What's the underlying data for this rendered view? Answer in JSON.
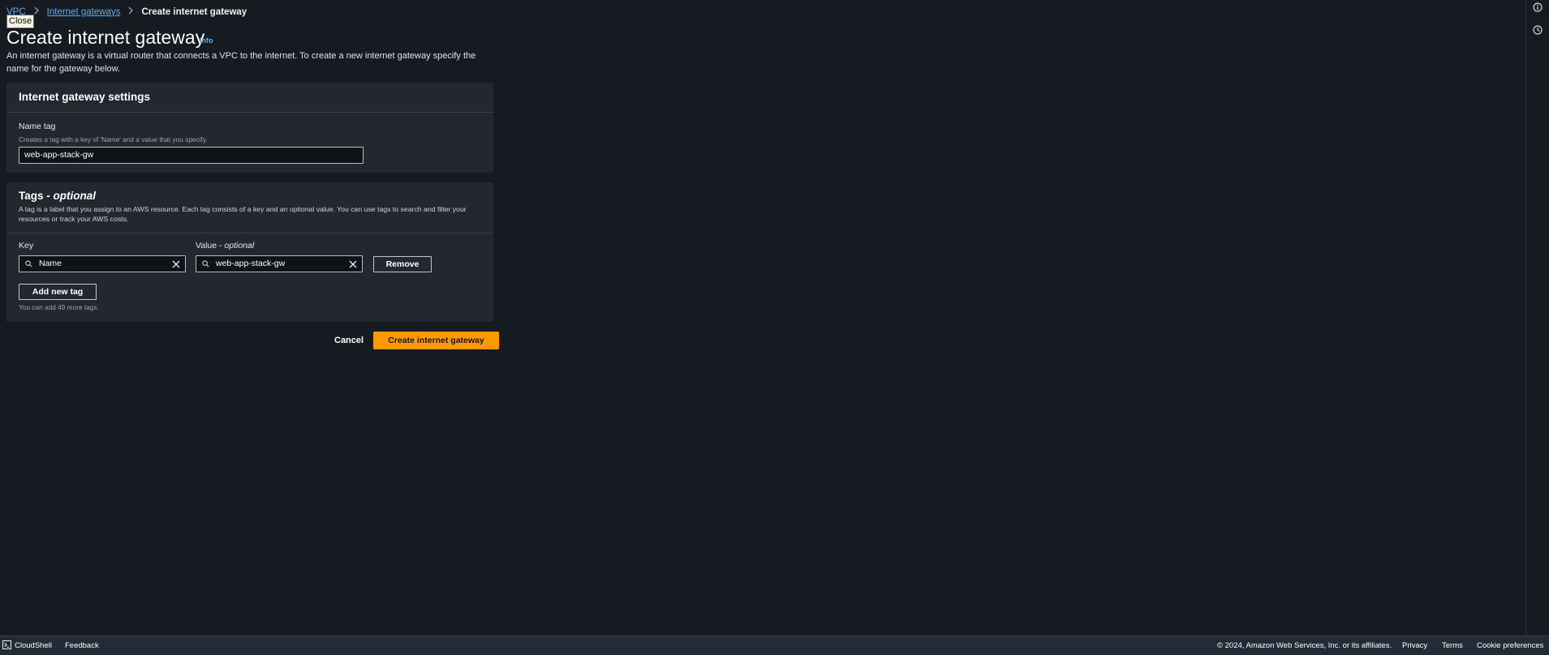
{
  "breadcrumb": {
    "root": "VPC",
    "parent": "Internet gateways",
    "current": "Create internet gateway"
  },
  "tooltip": "Close",
  "page": {
    "title": "Create internet gateway",
    "info": "Info",
    "description": "An internet gateway is a virtual router that connects a VPC to the internet. To create a new internet gateway specify the name for the gateway below."
  },
  "settings": {
    "header": "Internet gateway settings",
    "name_label": "Name tag",
    "name_hint": "Creates a tag with a key of 'Name' and a value that you specify.",
    "name_value": "web-app-stack-gw"
  },
  "tags": {
    "header": "Tags - ",
    "header_optional": "optional",
    "description": "A tag is a label that you assign to an AWS resource. Each tag consists of a key and an optional value. You can use tags to search and filter your resources or track your AWS costs.",
    "key_label": "Key",
    "value_label": "Value - ",
    "value_label_optional": "optional",
    "key_value": "Name",
    "value_value": "web-app-stack-gw",
    "remove": "Remove",
    "add": "Add new tag",
    "add_hint": "You can add 49 more tags."
  },
  "actions": {
    "cancel": "Cancel",
    "submit": "Create internet gateway"
  },
  "footer": {
    "cloudshell": "CloudShell",
    "feedback": "Feedback",
    "copyright": "© 2024, Amazon Web Services, Inc. or its affiliates.",
    "privacy": "Privacy",
    "terms": "Terms",
    "cookies": "Cookie preferences"
  },
  "icons": {
    "breadcrumb": "chevron-right-icon",
    "search": "search-icon",
    "clear": "close-icon",
    "rail_info": "info-circle-icon",
    "rail_history": "clock-icon",
    "cloudshell": "terminal-icon"
  },
  "colors": {
    "primary": "#ff9900",
    "link": "#5ab0f0",
    "background": "#161a21",
    "panel": "#232830"
  }
}
